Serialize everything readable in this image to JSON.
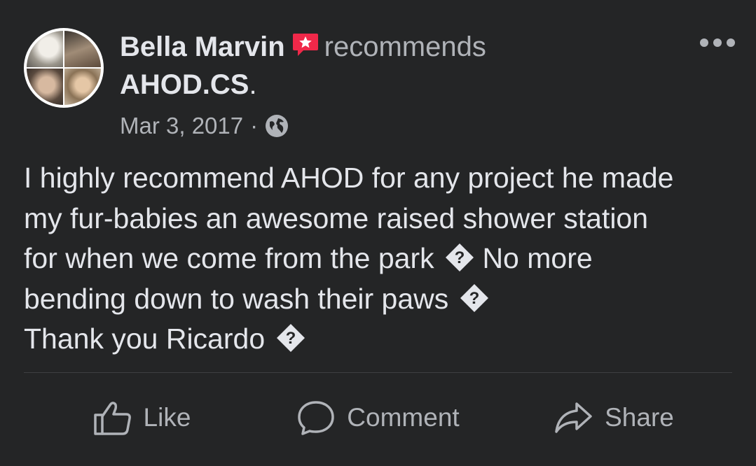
{
  "post": {
    "author_name": "Bella Marvin",
    "action_text": "recommends",
    "page_name": "AHOD.CS",
    "page_suffix": ".",
    "date": "Mar 3, 2017",
    "separator": "·",
    "privacy_icon": "globe-icon",
    "more_icon": "more-options-icon",
    "body_lines": [
      "I highly recommend AHOD for any project he made",
      "my fur-babies an awesome raised shower station",
      "for when we come from the park",
      "No more",
      "bending down to wash their paws",
      "Thank you Ricardo"
    ],
    "unknown_glyph_icon": "unknown-character-icon"
  },
  "actions": {
    "like_label": "Like",
    "comment_label": "Comment",
    "share_label": "Share"
  },
  "colors": {
    "background": "#242526",
    "primary_text": "#e4e6eb",
    "secondary_text": "#b0b3b8",
    "recommend_badge": "#f02849",
    "divider": "#3e4042"
  }
}
